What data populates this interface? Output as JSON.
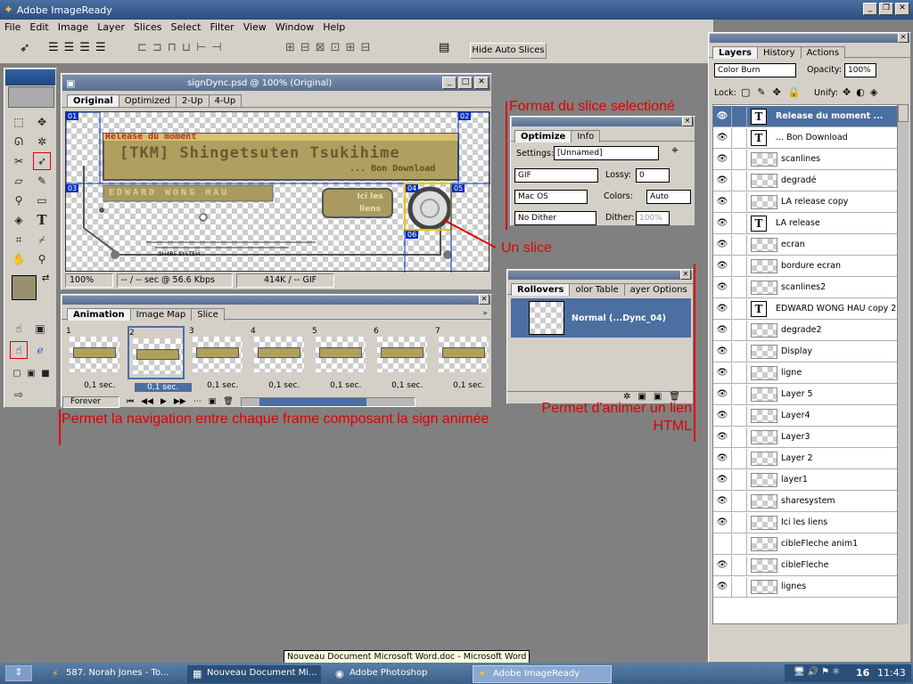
{
  "app": {
    "title": "Adobe ImageReady"
  },
  "menu": [
    "File",
    "Edit",
    "Image",
    "Layer",
    "Slices",
    "Select",
    "Filter",
    "View",
    "Window",
    "Help"
  ],
  "toolbar": {
    "hide_slices": "Hide Auto Slices"
  },
  "doc": {
    "title": "signDync.psd @ 100% (Original)",
    "tabs": [
      "Original",
      "Optimized",
      "2-Up",
      "4-Up"
    ],
    "sign_line1": "Release du moment",
    "sign_line2": "[TKM] Shingetsuten Tsukihime",
    "sign_line3": "... Bon Download",
    "sign_line4": "EDWARD WONG HAU",
    "sign_button": "Ici les liens",
    "share_label": "SHARE SYSTEM",
    "slice_labels": [
      "01",
      "02",
      "03",
      "04",
      "05",
      "06"
    ],
    "status": {
      "zoom": "100%",
      "speed": "-- / -- sec @ 56.6 Kbps",
      "size": "414K / -- GIF"
    }
  },
  "animation": {
    "tabs": [
      "Animation",
      "Image Map",
      "Slice"
    ],
    "frames": [
      {
        "n": "1",
        "delay": "0,1 sec."
      },
      {
        "n": "2",
        "delay": "0,1 sec."
      },
      {
        "n": "3",
        "delay": "0,1 sec."
      },
      {
        "n": "4",
        "delay": "0,1 sec."
      },
      {
        "n": "5",
        "delay": "0,1 sec."
      },
      {
        "n": "6",
        "delay": "0,1 sec."
      },
      {
        "n": "7",
        "delay": "0,1 sec."
      }
    ],
    "loop": "Forever"
  },
  "optimize": {
    "tabs": [
      "Optimize",
      "Info"
    ],
    "settings_label": "Settings:",
    "settings_value": "[Unnamed]",
    "format": "GIF",
    "lossy_label": "Lossy:",
    "lossy_value": "0",
    "palette": "Mac OS",
    "colors_label": "Colors:",
    "colors_value": "Auto",
    "dither_mode": "No Dither",
    "dither_label": "Dither:",
    "dither_value": "100%"
  },
  "rollovers": {
    "tabs": [
      "Rollovers",
      "olor Table",
      "ayer Options"
    ],
    "state": "Normal (...Dync_04)"
  },
  "layers": {
    "tabs": [
      "Layers",
      "History",
      "Actions"
    ],
    "blend": "Color Burn",
    "opacity_label": "Opacity:",
    "opacity": "100%",
    "lock_label": "Lock:",
    "unify_label": "Unify:",
    "items": [
      {
        "name": "Release du moment ...",
        "type": "text",
        "visible": true,
        "selected": true
      },
      {
        "name": "... Bon Download",
        "type": "text",
        "visible": true
      },
      {
        "name": "scanlines",
        "type": "image",
        "visible": true
      },
      {
        "name": "degradé",
        "type": "image",
        "visible": true
      },
      {
        "name": "LA release copy",
        "type": "image",
        "visible": true
      },
      {
        "name": "LA release",
        "type": "text",
        "visible": true
      },
      {
        "name": "ecran",
        "type": "image",
        "visible": true
      },
      {
        "name": "bordure ecran",
        "type": "image",
        "visible": true
      },
      {
        "name": "scanlines2",
        "type": "image",
        "visible": true
      },
      {
        "name": "EDWARD WONG HAU copy 2",
        "type": "text",
        "visible": true
      },
      {
        "name": "degrade2",
        "type": "image",
        "visible": true
      },
      {
        "name": "Display",
        "type": "image",
        "visible": true
      },
      {
        "name": "ligne",
        "type": "image",
        "visible": true
      },
      {
        "name": "Layer 5",
        "type": "image",
        "visible": true
      },
      {
        "name": "Layer4",
        "type": "image",
        "visible": true
      },
      {
        "name": "Layer3",
        "type": "image",
        "visible": true
      },
      {
        "name": "Layer 2",
        "type": "image",
        "visible": true
      },
      {
        "name": "layer1",
        "type": "image",
        "visible": true
      },
      {
        "name": "sharesystem",
        "type": "image",
        "visible": true
      },
      {
        "name": "Ici les liens",
        "type": "image",
        "visible": true
      },
      {
        "name": "cibleFleche anim1",
        "type": "image",
        "visible": false
      },
      {
        "name": "cibleFleche",
        "type": "image",
        "visible": true
      },
      {
        "name": "lignes",
        "type": "image",
        "visible": true
      }
    ]
  },
  "annotations": {
    "format": "Format du slice selectioné",
    "slice": "Un slice",
    "nav": "Permet la navigation entre chaque frame composant la sign animée",
    "anim": "Permet d'animer un lien HTML"
  },
  "tooltip": "Nouveau Document Microsoft Word.doc - Microsoft Word",
  "taskbar": {
    "items": [
      "587. Norah Jones - To...",
      "Nouveau Document Mi...",
      "Adobe Photoshop",
      "Adobe ImageReady"
    ],
    "tray_num": "16",
    "clock": "11:43"
  },
  "colors": {
    "accent": "#4a6fa0",
    "annotation": "#e00000",
    "desktop": "#808080"
  }
}
